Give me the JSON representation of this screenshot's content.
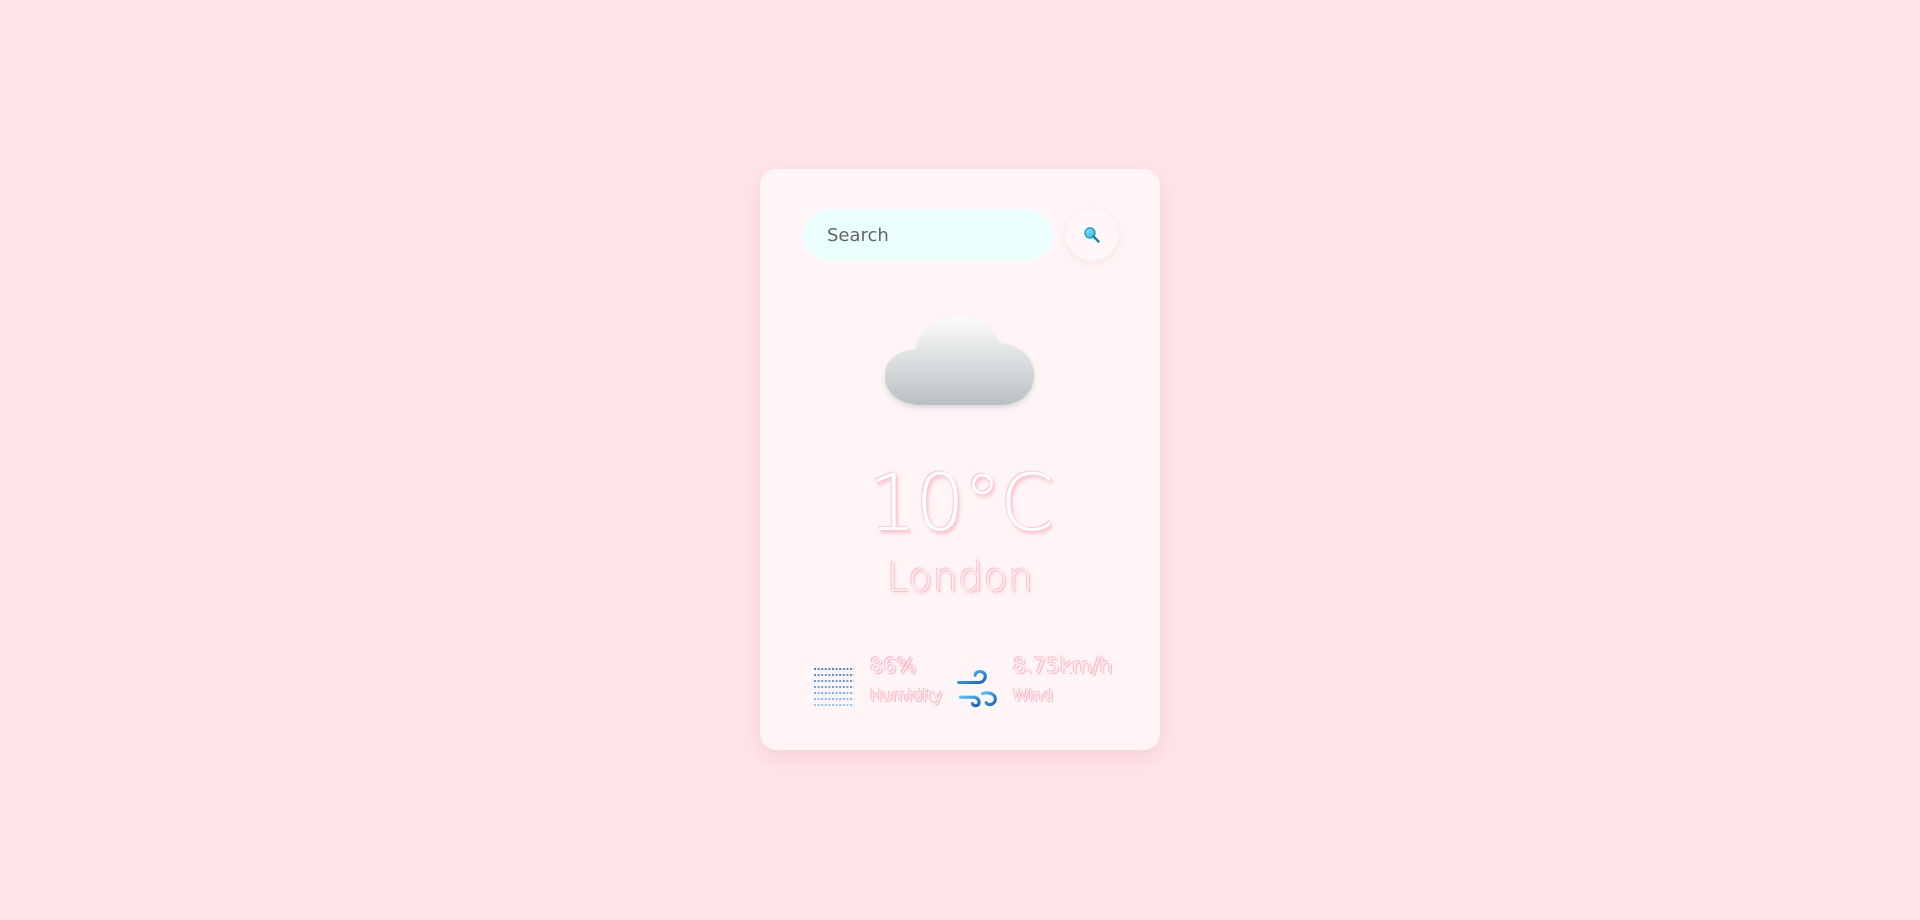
{
  "search": {
    "placeholder": "Search",
    "button_icon": "search-icon"
  },
  "weather": {
    "icon": "cloud-icon",
    "temperature": "10°C",
    "city": "London"
  },
  "details": {
    "humidity": {
      "icon": "humidity-icon",
      "value": "86%",
      "label": "Humidity"
    },
    "wind": {
      "icon": "wind-icon",
      "value": "8.75km/h",
      "label": "Wind"
    }
  },
  "colors": {
    "background": "#ffe6eb",
    "card": "#fff5f6",
    "search_field": "#eafffb",
    "accent_pink": "#ffb6c6",
    "icon_blue": "#1e88e5"
  }
}
